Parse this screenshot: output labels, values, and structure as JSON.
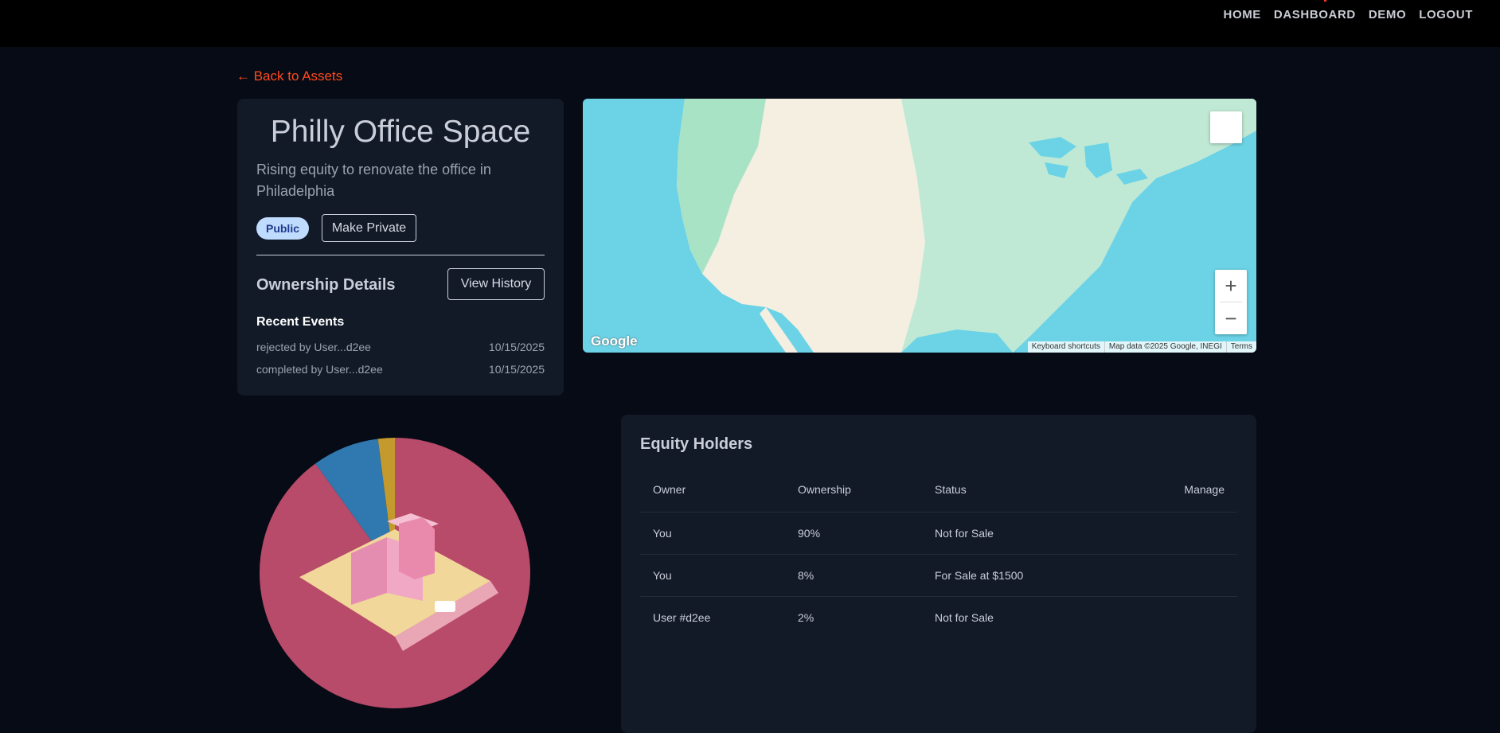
{
  "nav": {
    "items": [
      "HOME",
      "DASHBOARD",
      "DEMO",
      "LOGOUT"
    ]
  },
  "back_link": "← Back to Assets",
  "asset": {
    "title": "Philly Office Space",
    "description": "Rising equity to renovate the office in Philadelphia",
    "visibility_badge": "Public",
    "make_private_label": "Make Private",
    "ownership_title": "Ownership Details",
    "view_history_label": "View History",
    "recent_events_title": "Recent Events",
    "events": [
      {
        "text": "rejected by User...d2ee",
        "date": "10/15/2025"
      },
      {
        "text": "completed by User...d2ee",
        "date": "10/15/2025"
      }
    ]
  },
  "map": {
    "zoom_in": "+",
    "zoom_out": "−",
    "logo": "Google",
    "attribution": [
      "Keyboard shortcuts",
      "Map data ©2025 Google, INEGI",
      "Terms"
    ],
    "colors": {
      "water": "#6cd3e6",
      "land": "#f4efe1",
      "green": "#bfe9d5"
    }
  },
  "ownership_pie": {
    "colors": [
      "#b84a6a",
      "#2f78b0",
      "#c49a2e"
    ]
  },
  "equity": {
    "title": "Equity Holders",
    "columns": [
      "Owner",
      "Ownership",
      "Status",
      "Manage"
    ],
    "rows": [
      {
        "owner": "You",
        "ownership": "90%",
        "status": "Not for Sale"
      },
      {
        "owner": "You",
        "ownership": "8%",
        "status": "For Sale at $1500"
      },
      {
        "owner": "User #d2ee",
        "ownership": "2%",
        "status": "Not for Sale"
      }
    ]
  },
  "chart_data": {
    "type": "pie",
    "categories": [
      "You",
      "You",
      "User #d2ee"
    ],
    "values": [
      90,
      8,
      2
    ]
  }
}
